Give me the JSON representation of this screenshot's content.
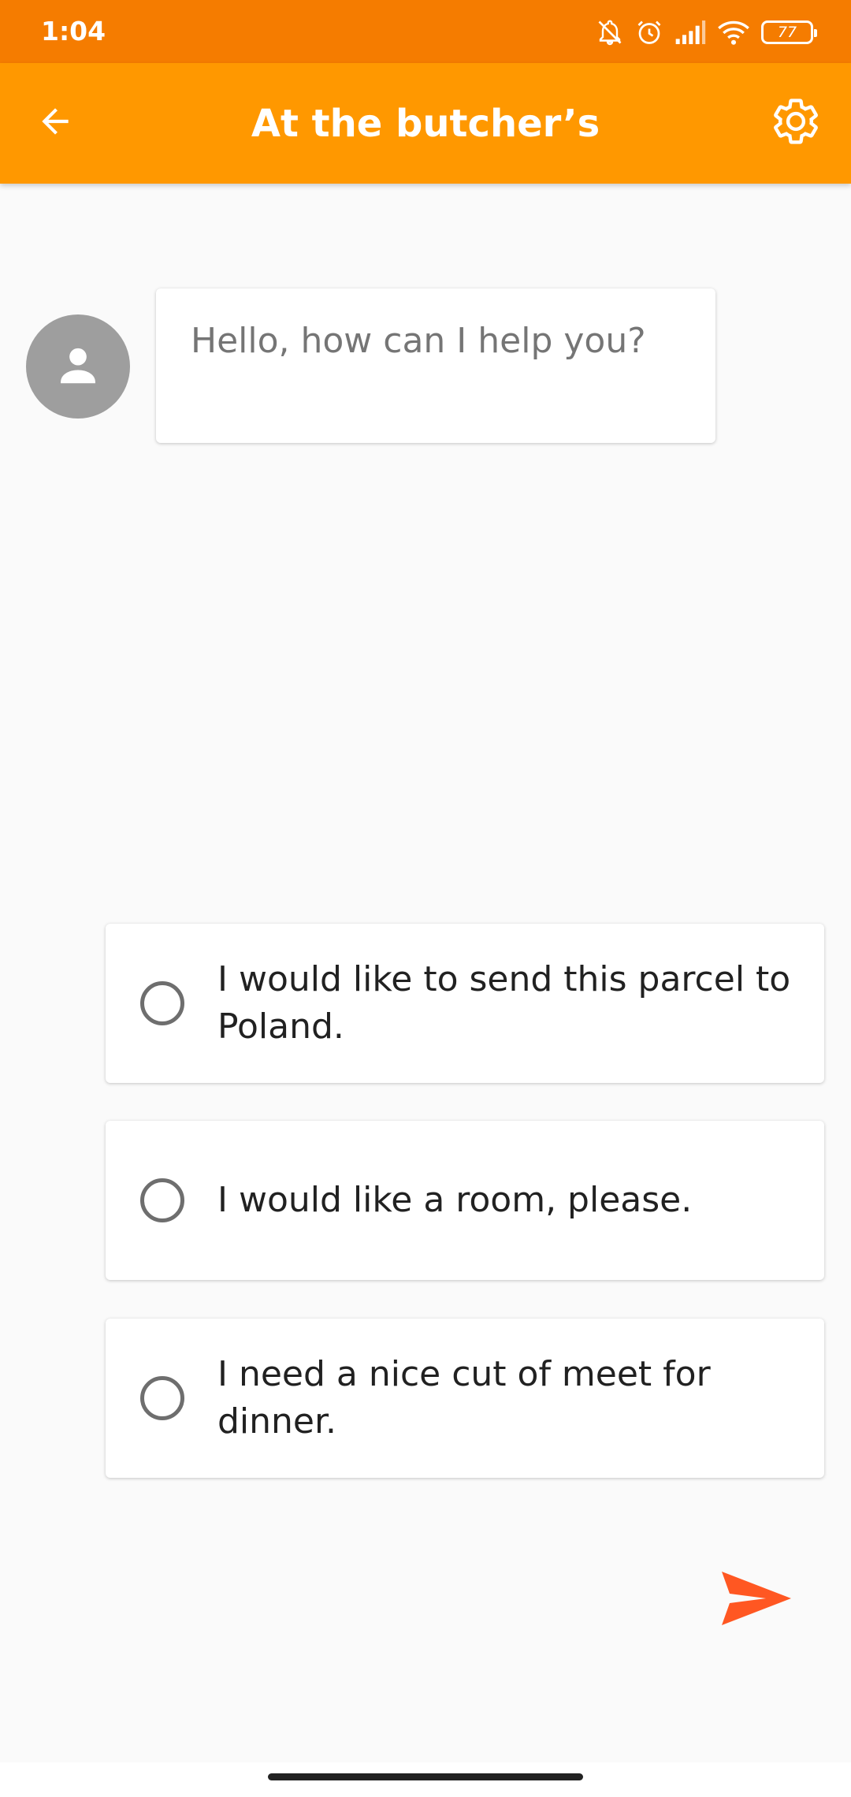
{
  "status_bar": {
    "time": "1:04",
    "battery": "77",
    "icons": [
      "notifications-off-icon",
      "alarm-icon",
      "signal-icon",
      "wifi-icon",
      "battery-icon"
    ],
    "background_color": "#f57c00"
  },
  "app_bar": {
    "title": "At the butcher’s",
    "back_icon": "arrow-back-icon",
    "settings_icon": "gear-icon",
    "background_color": "#ff9800"
  },
  "conversation": {
    "avatar_icon": "person-icon",
    "message": "Hello, how can I help you?"
  },
  "options": [
    {
      "label": "I would like to send this parcel to Poland.",
      "selected": false
    },
    {
      "label": "I would like a room, please.",
      "selected": false
    },
    {
      "label": "I need a nice cut of meet for dinner.",
      "selected": false
    }
  ],
  "send": {
    "icon": "send-icon",
    "color": "#ff5722"
  }
}
